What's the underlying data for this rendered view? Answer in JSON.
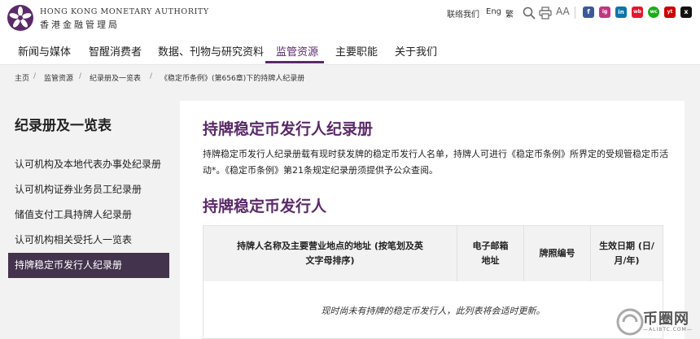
{
  "header": {
    "org_en": "HONG KONG MONETARY AUTHORITY",
    "org_zh": "香港金融管理局",
    "contact": "联络我们",
    "lang_en": "Eng",
    "lang_tc": "繁",
    "font_size_label": "AA",
    "social": [
      "f",
      "ig",
      "in",
      "wb",
      "wc",
      "yt",
      "x",
      "ot"
    ]
  },
  "nav": {
    "items": [
      "新闻与媒体",
      "智醒消费者",
      "数据、刊物与研究资料",
      "监管资源",
      "主要职能",
      "关于我们"
    ],
    "active_index": 3
  },
  "breadcrumb": [
    "主页",
    "监管资源",
    "纪录册及一览表",
    "《稳定币条例》(第656章)下的持牌人纪录册"
  ],
  "sidebar": {
    "title": "纪录册及一览表",
    "items": [
      "认可机构及本地代表办事处纪录册",
      "认可机构证券业务员工纪录册",
      "储值支付工具持牌人纪录册",
      "认可机构相关受托人一览表",
      "持牌稳定币发行人纪录册"
    ],
    "active_index": 4
  },
  "main": {
    "title": "持牌稳定币发行人纪录册",
    "paragraph": "持牌稳定币发行人纪录册载有现时获发牌的稳定币发行人名单，持牌人可进行《稳定币条例》所界定的受规管稳定币活动*。《稳定币条例》第21条规定纪录册须提供予公众查阅。",
    "section_title": "持牌稳定币发行人",
    "table": {
      "headers": [
        "持牌人名称及主要营业地点的地址 (按笔划及英文字母排序)",
        "电子邮箱地址",
        "牌照编号",
        "生效日期 (日/月/年)"
      ],
      "empty_message": "现时尚未有持牌的稳定币发行人，此列表将会适时更新。"
    }
  },
  "watermark": {
    "text": "币圈网",
    "sub": "—ALIBTC.COM—"
  },
  "colors": {
    "brand_purple": "#5b2a69",
    "sidebar_active": "#43334d",
    "page_bg": "#f2f2f2"
  }
}
